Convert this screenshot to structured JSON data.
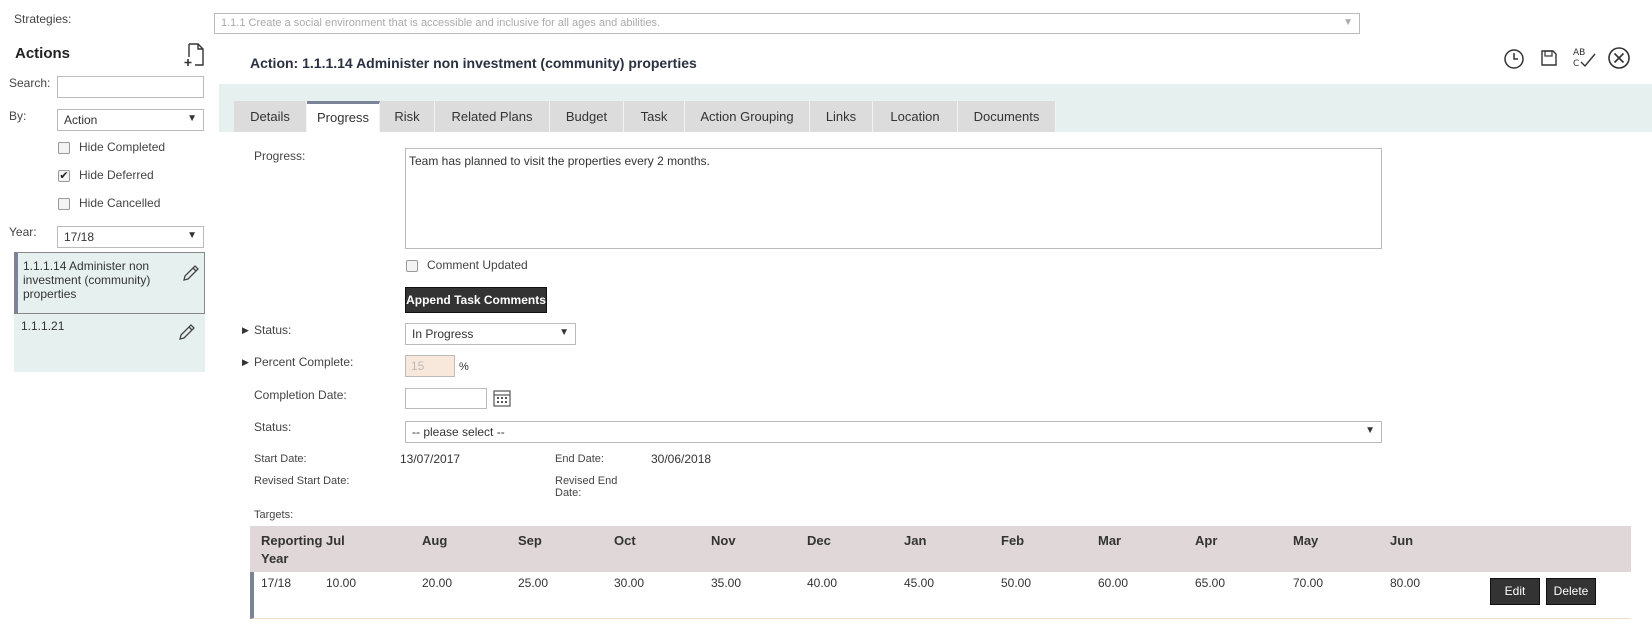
{
  "strategies": {
    "label": "Strategies:",
    "value": "1.1.1 Create a social environment that is accessible and inclusive for all ages and abilities."
  },
  "sidebar": {
    "title": "Actions",
    "search_label": "Search:",
    "by_label": "By:",
    "by_value": "Action",
    "filters": [
      {
        "label": "Hide Completed",
        "checked": false
      },
      {
        "label": "Hide Deferred",
        "checked": true
      },
      {
        "label": "Hide Cancelled",
        "checked": false
      }
    ],
    "year_label": "Year:",
    "year_value": "17/18",
    "items": [
      {
        "label": "1.1.1.14 Administer non investment (community) properties",
        "selected": true
      },
      {
        "label": "1.1.1.21",
        "selected": false
      }
    ]
  },
  "header": {
    "title": "Action: 1.1.1.14 Administer non investment (community) properties"
  },
  "tabs": [
    "Details",
    "Progress",
    "Risk",
    "Related Plans",
    "Budget",
    "Task",
    "Action Grouping",
    "Links",
    "Location",
    "Documents"
  ],
  "active_tab": "Progress",
  "form": {
    "progress_label": "Progress:",
    "progress_text": "Team has planned to visit the properties every 2 months.",
    "comment_updated_label": "Comment Updated",
    "append_button": "Append Task Comments",
    "status_label": "Status:",
    "status_value": "In Progress",
    "percent_label": "Percent Complete:",
    "percent_value": "15",
    "percent_unit": "%",
    "completion_label": "Completion Date:",
    "status2_label": "Status:",
    "status2_value": "-- please select --",
    "start_label": "Start Date:",
    "start_value": "13/07/2017",
    "end_label": "End Date:",
    "end_value": "30/06/2018",
    "rev_start_label": "Revised Start Date:",
    "rev_end_label_1": "Revised End",
    "rev_end_label_2": "Date:",
    "targets_label": "Targets:"
  },
  "targets": {
    "headers": [
      "Reporting",
      "Year",
      "Jul",
      "Aug",
      "Sep",
      "Oct",
      "Nov",
      "Dec",
      "Jan",
      "Feb",
      "Mar",
      "Apr",
      "May",
      "Jun"
    ],
    "row": {
      "year": "17/18",
      "values": [
        "10.00",
        "20.00",
        "25.00",
        "30.00",
        "35.00",
        "40.00",
        "45.00",
        "50.00",
        "60.00",
        "65.00",
        "70.00",
        "80.00"
      ]
    },
    "edit_button": "Edit",
    "delete_button": "Delete"
  },
  "toolbar_icons": [
    "history-icon",
    "save-icon",
    "spellcheck-icon",
    "close-icon"
  ],
  "colors": {
    "accent_border": "#7b8496",
    "tab_bar": "#e6f1ef",
    "selected_item": "#e6f1ef",
    "percent_bg": "#f8e8dc"
  }
}
